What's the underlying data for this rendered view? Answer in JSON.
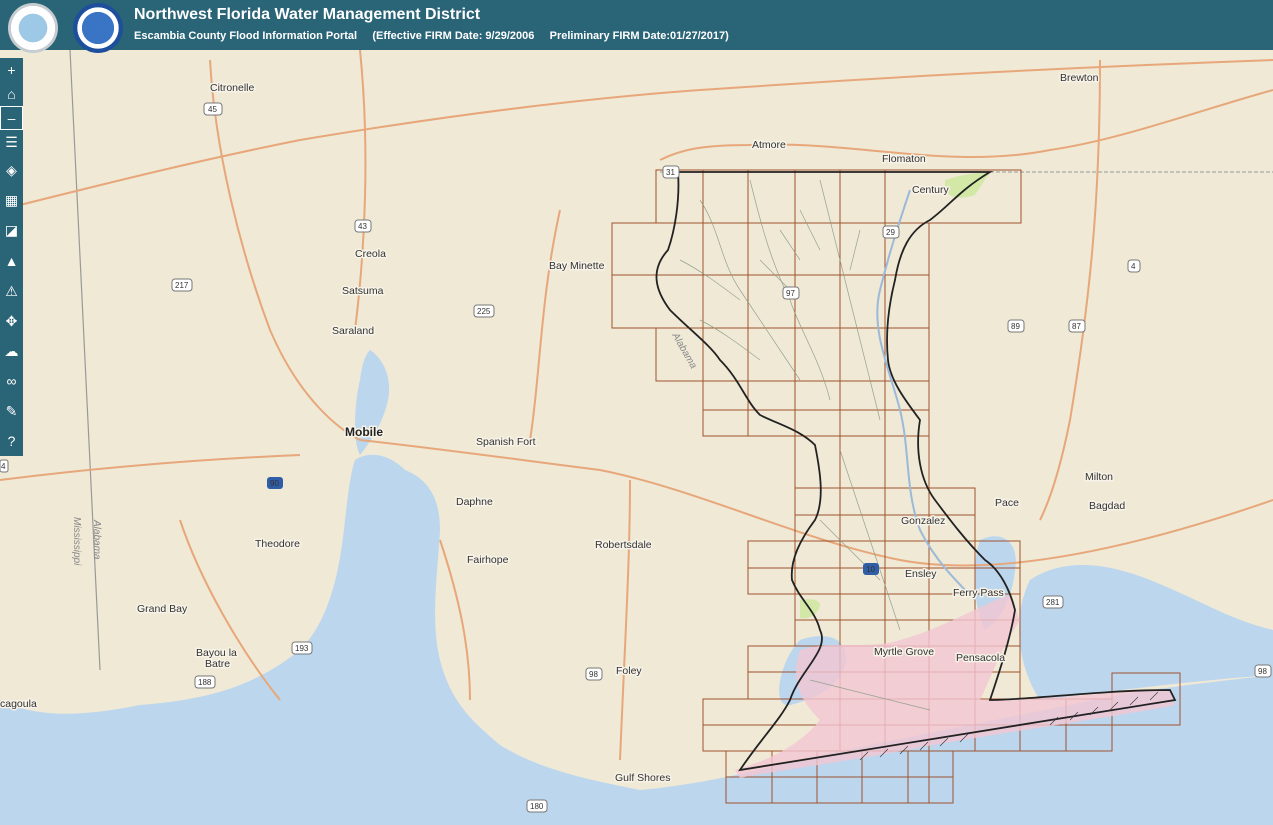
{
  "header": {
    "title": "Northwest Florida Water Management District",
    "subtitle": "Escambia County Flood Information Portal     (Effective FIRM Date: 9/29/2006     Preliminary FIRM Date:01/27/2017)"
  },
  "toolbar": {
    "tools": [
      {
        "name": "zoom-in-button",
        "icon": "plus",
        "glyph": "+"
      },
      {
        "name": "home-button",
        "icon": "home",
        "glyph": "⌂"
      },
      {
        "name": "zoom-out-button",
        "icon": "minus",
        "glyph": "–"
      },
      {
        "name": "legend-button",
        "icon": "list",
        "glyph": "☰"
      },
      {
        "name": "layers-button",
        "icon": "layers",
        "glyph": "◈"
      },
      {
        "name": "basemap-button",
        "icon": "basemap-grid",
        "glyph": "▦"
      },
      {
        "name": "overview-button",
        "icon": "overview",
        "glyph": "◪"
      },
      {
        "name": "navigation-button",
        "icon": "arrow-north",
        "glyph": "▲"
      },
      {
        "name": "warning-button",
        "icon": "warning",
        "glyph": "⚠"
      },
      {
        "name": "measure-button",
        "icon": "measure",
        "glyph": "✥"
      },
      {
        "name": "upload-button",
        "icon": "cloud-upload",
        "glyph": "☁"
      },
      {
        "name": "link-button",
        "icon": "link",
        "glyph": "∞"
      },
      {
        "name": "comment-button",
        "icon": "speech-bubble",
        "glyph": "✎"
      },
      {
        "name": "help-button",
        "icon": "help",
        "glyph": "?"
      }
    ]
  },
  "map": {
    "places": [
      {
        "label": "Citronelle",
        "size": "normal"
      },
      {
        "label": "Brewton",
        "size": "normal"
      },
      {
        "label": "Atmore",
        "size": "normal"
      },
      {
        "label": "Flomaton",
        "size": "normal"
      },
      {
        "label": "Century",
        "size": "normal"
      },
      {
        "label": "Creola",
        "size": "normal"
      },
      {
        "label": "Bay Minette",
        "size": "normal"
      },
      {
        "label": "Satsuma",
        "size": "normal"
      },
      {
        "label": "Saraland",
        "size": "normal"
      },
      {
        "label": "Mobile",
        "size": "big"
      },
      {
        "label": "Spanish Fort",
        "size": "normal"
      },
      {
        "label": "Daphne",
        "size": "normal"
      },
      {
        "label": "Fairhope",
        "size": "normal"
      },
      {
        "label": "Robertsdale",
        "size": "normal"
      },
      {
        "label": "Theodore",
        "size": "normal"
      },
      {
        "label": "Grand Bay",
        "size": "normal"
      },
      {
        "label": "Bayou la",
        "size": "normal"
      },
      {
        "label": "Batre",
        "size": "normal"
      },
      {
        "label": "cagoula",
        "size": "normal"
      },
      {
        "label": "Foley",
        "size": "normal"
      },
      {
        "label": "Gulf Shores",
        "size": "normal"
      },
      {
        "label": "Milton",
        "size": "normal"
      },
      {
        "label": "Bagdad",
        "size": "normal"
      },
      {
        "label": "Pace",
        "size": "normal"
      },
      {
        "label": "Gonzalez",
        "size": "normal"
      },
      {
        "label": "Ensley",
        "size": "normal"
      },
      {
        "label": "Ferry Pass",
        "size": "normal"
      },
      {
        "label": "Myrtle Grove",
        "size": "normal"
      },
      {
        "label": "Pensacola",
        "size": "normal"
      }
    ],
    "shields": [
      "45",
      "43",
      "217",
      "225",
      "31",
      "29",
      "97",
      "89",
      "87",
      "4",
      "90",
      "10",
      "193",
      "188",
      "98",
      "98",
      "281",
      "180",
      "4"
    ],
    "state_labels": [
      "Alabama",
      "Mississippi",
      "Alabama"
    ],
    "colors": {
      "water": "#bcd6ee",
      "land": "#efe9d6",
      "road": "#e7a77a",
      "grid": "#a0522d",
      "boundary": "#222222",
      "flood": "#f2c6d2",
      "zone": "#cfe8a2"
    }
  }
}
